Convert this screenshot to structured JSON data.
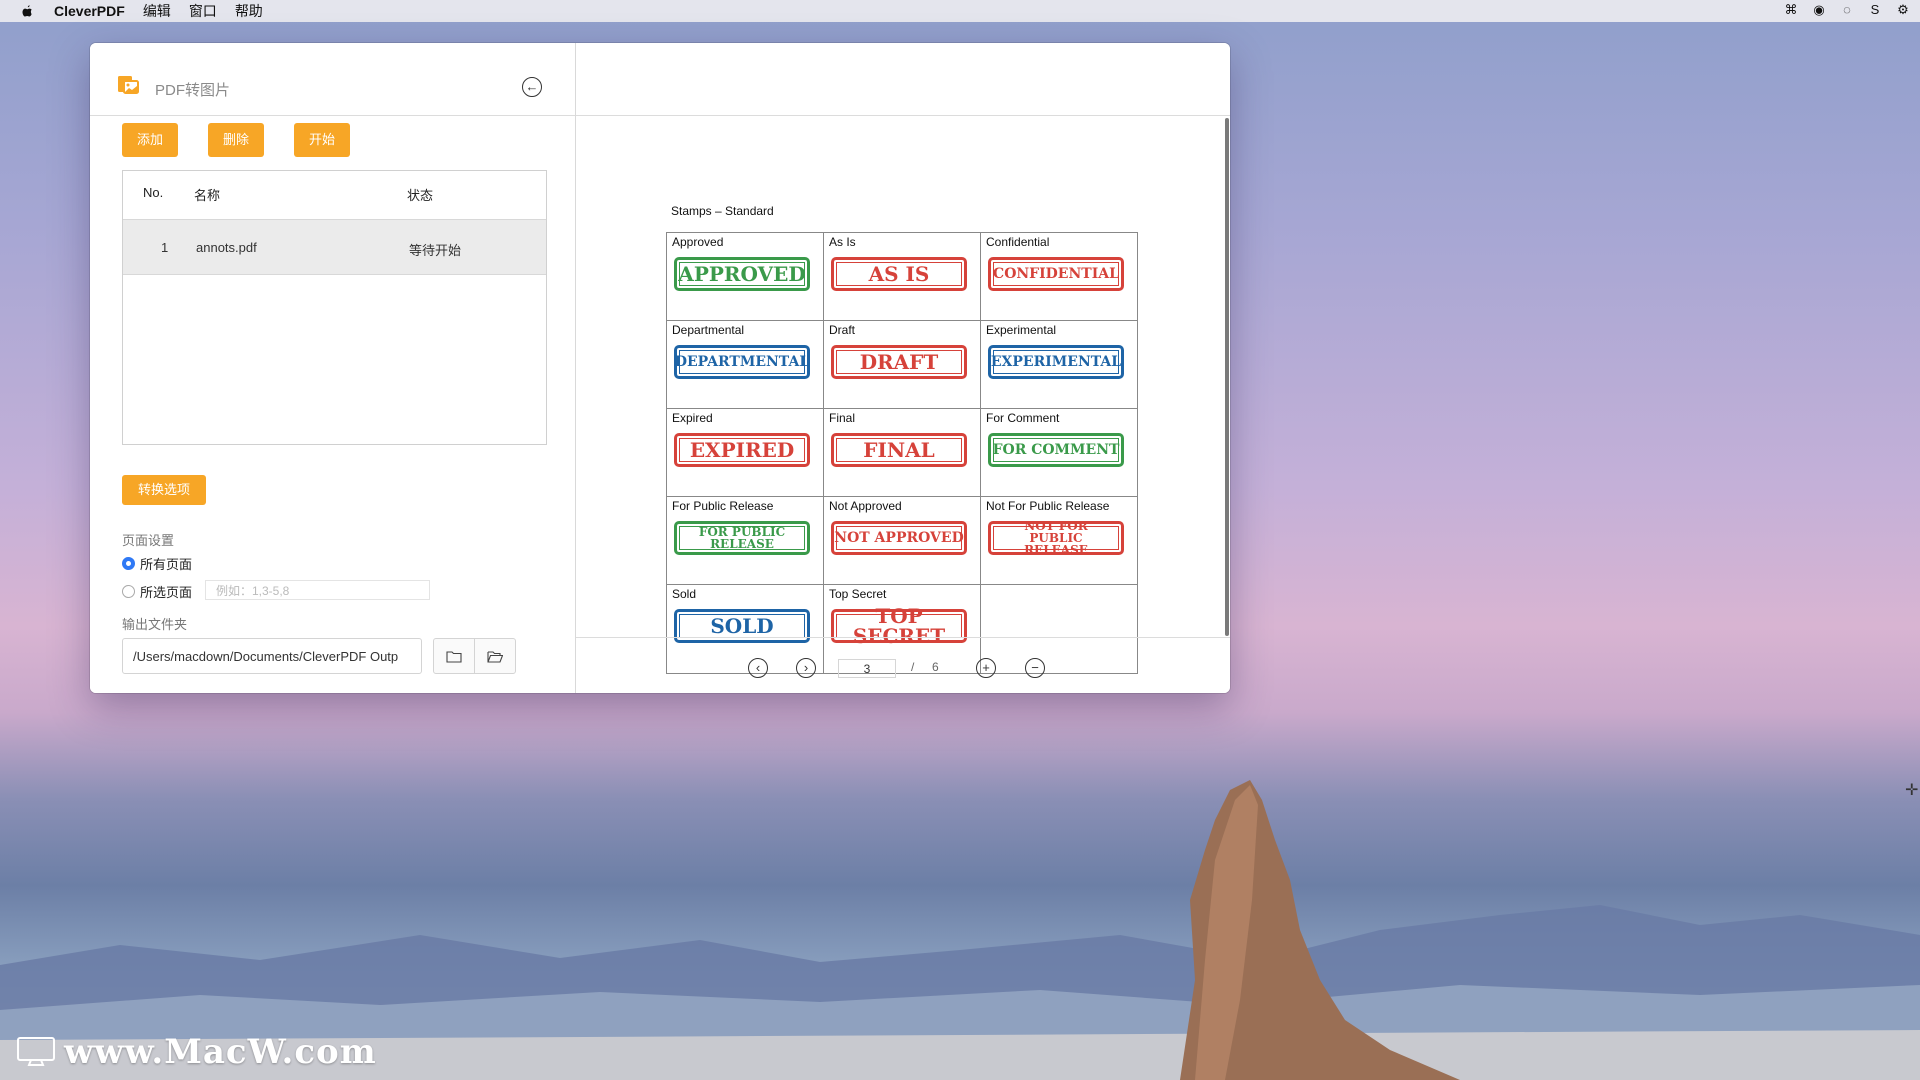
{
  "menubar": {
    "app_name": "CleverPDF",
    "items": [
      "编辑",
      "窗口",
      "帮助"
    ]
  },
  "window": {
    "title": "PDF转图片",
    "buttons": {
      "add": "添加",
      "delete": "删除",
      "start": "开始"
    },
    "table": {
      "headers": {
        "no": "No.",
        "name": "名称",
        "status": "状态"
      },
      "rows": [
        {
          "no": "1",
          "name": "annots.pdf",
          "status": "等待开始"
        }
      ]
    },
    "options_button": "转换选项",
    "page_settings_label": "页面设置",
    "radio_all": "所有页面",
    "radio_selected": "所选页面",
    "pages_placeholder": "例如：1,3-5,8",
    "output_label": "输出文件夹",
    "output_path": "/Users/macdown/Documents/CleverPDF Outp"
  },
  "preview": {
    "doc_title": "Stamps – Standard",
    "stamps": [
      {
        "label": "Approved",
        "stamp": "APPROVED",
        "color": "green"
      },
      {
        "label": "As Is",
        "stamp": "AS IS",
        "color": "red"
      },
      {
        "label": "Confidential",
        "stamp": "CONFIDENTIAL",
        "color": "red"
      },
      {
        "label": "Departmental",
        "stamp": "DEPARTMENTAL",
        "color": "blue"
      },
      {
        "label": "Draft",
        "stamp": "DRAFT",
        "color": "red"
      },
      {
        "label": "Experimental",
        "stamp": "EXPERIMENTAL",
        "color": "blue"
      },
      {
        "label": "Expired",
        "stamp": "EXPIRED",
        "color": "red"
      },
      {
        "label": "Final",
        "stamp": "FINAL",
        "color": "red"
      },
      {
        "label": "For Comment",
        "stamp": "FOR COMMENT",
        "color": "green"
      },
      {
        "label": "For Public Release",
        "stamp": "FOR PUBLIC RELEASE",
        "color": "green"
      },
      {
        "label": "Not Approved",
        "stamp": "NOT APPROVED",
        "color": "red"
      },
      {
        "label": "Not For Public Release",
        "stamp": "NOT FOR PUBLIC RELEASE",
        "color": "red"
      },
      {
        "label": "Sold",
        "stamp": "SOLD",
        "color": "blue"
      },
      {
        "label": "Top Secret",
        "stamp": "TOP SECRET",
        "color": "red"
      }
    ],
    "pager": {
      "current_page": "3",
      "separator": "/",
      "total_pages": "6"
    }
  },
  "watermark": "www.MacW.com",
  "colors": {
    "accent_orange": "#f7a626",
    "radio_blue": "#2f79f5",
    "stamp_green": "#3a9a4a",
    "stamp_red": "#d6423a",
    "stamp_blue": "#1e64a6"
  }
}
